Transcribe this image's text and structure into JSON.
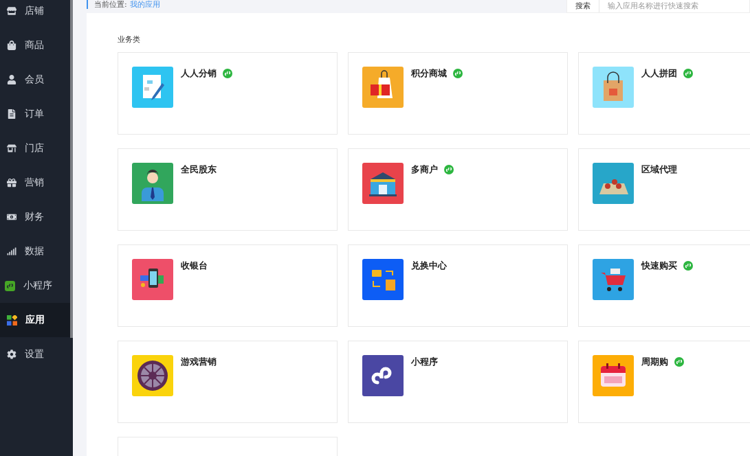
{
  "sidebar": {
    "items": [
      {
        "label": "店铺",
        "selected": false
      },
      {
        "label": "商品",
        "selected": false
      },
      {
        "label": "会员",
        "selected": false
      },
      {
        "label": "订单",
        "selected": false
      },
      {
        "label": "门店",
        "selected": false
      },
      {
        "label": "营销",
        "selected": false
      },
      {
        "label": "财务",
        "selected": false
      },
      {
        "label": "数据",
        "selected": false
      },
      {
        "label": "小程序",
        "selected": false
      },
      {
        "label": "应用",
        "selected": true
      },
      {
        "label": "设置",
        "selected": false
      }
    ]
  },
  "breadcrumb": {
    "label": "当前位置:",
    "current": "我的应用"
  },
  "search": {
    "button": "搜索",
    "placeholder": "输入应用名称进行快速搜索"
  },
  "section": {
    "title": "业务类"
  },
  "apps": [
    {
      "title": "人人分销",
      "mini_program": true
    },
    {
      "title": "积分商城",
      "mini_program": true
    },
    {
      "title": "人人拼团",
      "mini_program": true
    },
    {
      "title": "全民股东",
      "mini_program": false
    },
    {
      "title": "多商户",
      "mini_program": true
    },
    {
      "title": "区域代理",
      "mini_program": false
    },
    {
      "title": "收银台",
      "mini_program": false
    },
    {
      "title": "兑换中心",
      "mini_program": false
    },
    {
      "title": "快速购买",
      "mini_program": true
    },
    {
      "title": "游戏营销",
      "mini_program": false
    },
    {
      "title": "小程序",
      "mini_program": false
    },
    {
      "title": "周期购",
      "mini_program": true
    },
    {
      "kind": "partial"
    }
  ]
}
